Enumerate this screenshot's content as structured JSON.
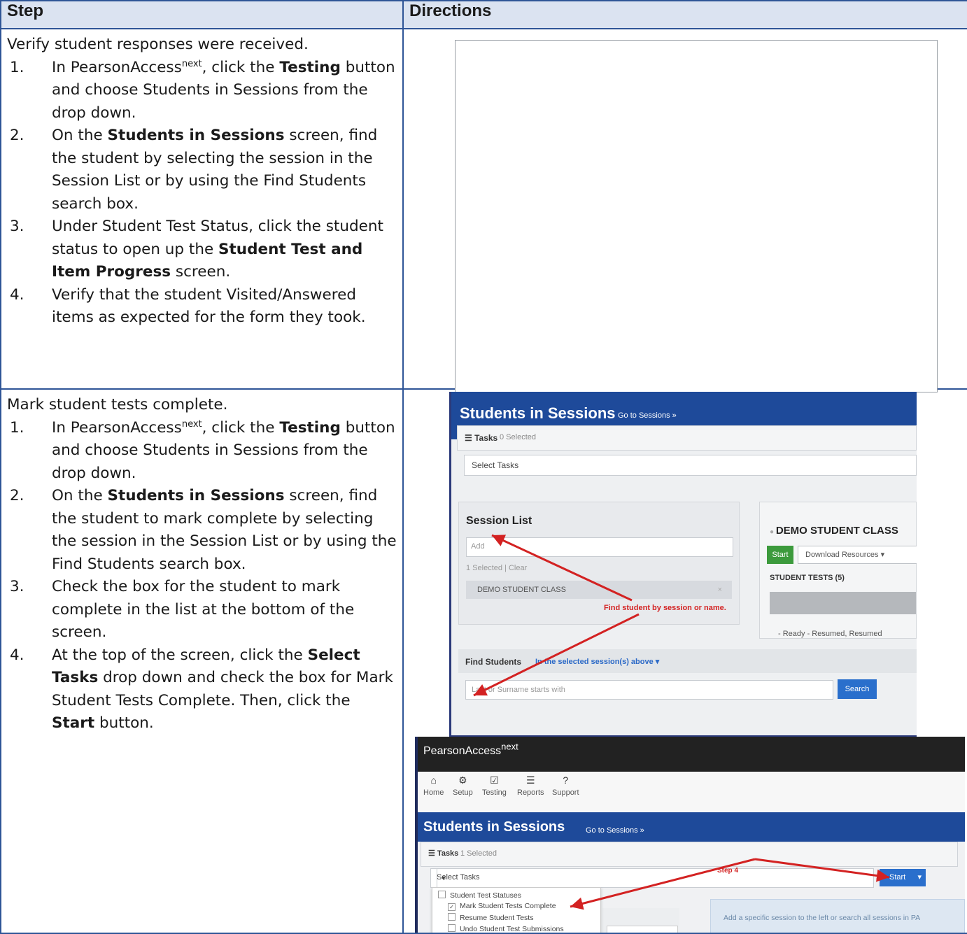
{
  "table": {
    "header_step": "Step",
    "header_directions": "Directions"
  },
  "row1": {
    "intro": "Verify student responses were received.",
    "items": [
      {
        "num": "1.",
        "pre": "In PearsonAccess",
        "sup": "next",
        "mid": ", click the ",
        "bold": "Testing",
        "post": " button and choose Students in Sessions from the drop down."
      },
      {
        "num": "2.",
        "pre": "On the ",
        "bold": "Students in Sessions",
        "post": " screen, find the student by selecting the session in the Session List or by using the Find Students search box."
      },
      {
        "num": "3.",
        "pre": "Under Student Test Status, click the student status to open up the ",
        "bold": "Student Test and Item Progress",
        "post": " screen."
      },
      {
        "num": "4.",
        "text": "Verify that the student Visited/Answered items as expected for the form they took."
      }
    ]
  },
  "row2": {
    "intro": "Mark student tests complete.",
    "items": [
      {
        "num": "1.",
        "pre": "In PearsonAccess",
        "sup": "next",
        "mid": ", click the ",
        "bold": "Testing",
        "post": " button and choose Students in Sessions from the drop down."
      },
      {
        "num": "2.",
        "pre": "On the ",
        "bold": "Students in Sessions",
        "post": " screen, find the student to mark complete by selecting the session in the Session List or by using the Find Students search box."
      },
      {
        "num": "3.",
        "text": "Check the box for the student to mark complete in the list at the bottom of the screen."
      },
      {
        "num": "4.",
        "pre": "At the top of the screen, click the ",
        "bold": "Select Tasks",
        "post": " drop down and check the box for Mark Student Tests Complete. Then, click the ",
        "bold2": "Start",
        "post2": " button."
      }
    ]
  },
  "shot1": {
    "title": "Students in Sessions",
    "goto": "Go to Sessions »",
    "tasks_label": "Tasks",
    "tasks_selected": "0 Selected",
    "select_tasks": "Select Tasks",
    "session_list": "Session List",
    "add_placeholder": "Add",
    "selected_clear": "1 Selected | Clear",
    "session_item": "DEMO STUDENT CLASS",
    "remove_glyph": "×",
    "class_title": "DEMO STUDENT CLASS",
    "start": "Start",
    "download": "Download Resources ▾",
    "student_tests": "STUDENT TESTS (5)",
    "legend": "- Ready   - Resumed, Resumed",
    "annotation": "Find student by session or name.",
    "find_label": "Find Students",
    "find_scope": "In the selected session(s) above  ▾",
    "find_placeholder": "Last or Surname starts with",
    "search": "Search"
  },
  "shot2": {
    "brand": "PearsonAccess",
    "brand_sup": "next",
    "nav": [
      {
        "icon": "⌂",
        "label": "Home"
      },
      {
        "icon": "⚙",
        "label": "Setup"
      },
      {
        "icon": "☑",
        "label": "Testing"
      },
      {
        "icon": "☰",
        "label": "Reports"
      },
      {
        "icon": "?",
        "label": "Support"
      }
    ],
    "title": "Students in Sessions",
    "goto": "Go to Sessions »",
    "tasks_label": "Tasks",
    "tasks_selected": "1 Selected",
    "select_tasks": "Select Tasks",
    "start": "Start",
    "annotation": "Step 4",
    "menu": [
      {
        "label": "Student Test Statuses",
        "checked": false
      },
      {
        "label": "Mark Student Tests Complete",
        "checked": true
      },
      {
        "label": "Resume Student Tests",
        "checked": false
      },
      {
        "label": "Undo Student Test Submissions",
        "checked": false
      }
    ],
    "info": "Add a specific session to the left or search all sessions in PA"
  },
  "colors": {
    "border": "#2f5597",
    "header_bg": "#dbe3f1",
    "app_blue": "#1e4a9a",
    "annotation_red": "#d32222"
  }
}
